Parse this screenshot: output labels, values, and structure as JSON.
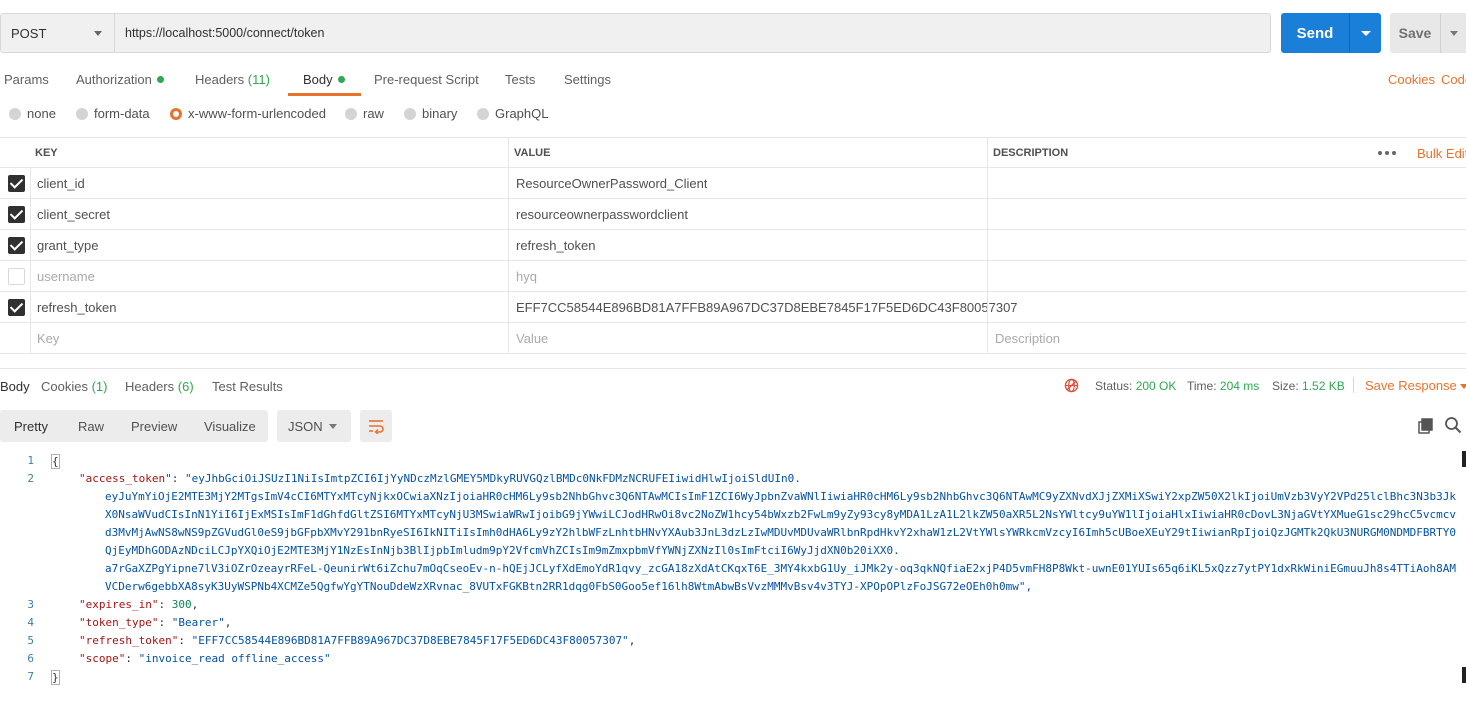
{
  "request": {
    "method": "POST",
    "url": "https://localhost:5000/connect/token",
    "send_label": "Send",
    "save_label": "Save"
  },
  "request_tabs": [
    {
      "label": "Params"
    },
    {
      "label": "Authorization",
      "dot": true
    },
    {
      "label": "Headers",
      "count": "(11)"
    },
    {
      "label": "Body",
      "dot": true,
      "active": true
    },
    {
      "label": "Pre-request Script"
    },
    {
      "label": "Tests"
    },
    {
      "label": "Settings"
    }
  ],
  "request_links": {
    "cookies": "Cookies",
    "code": "Code"
  },
  "body_types": {
    "none": "none",
    "form_data": "form-data",
    "urlencoded": "x-www-form-urlencoded",
    "raw": "raw",
    "binary": "binary",
    "graphql": "GraphQL",
    "selected": "x-www-form-urlencoded"
  },
  "params_table": {
    "headers": {
      "key": "KEY",
      "value": "VALUE",
      "description": "DESCRIPTION",
      "bulk_edit": "Bulk Edit"
    },
    "rows": [
      {
        "checked": true,
        "key": "client_id",
        "value": "ResourceOwnerPassword_Client",
        "description": ""
      },
      {
        "checked": true,
        "key": "client_secret",
        "value": "resourceownerpasswordclient",
        "description": ""
      },
      {
        "checked": true,
        "key": "grant_type",
        "value": "refresh_token",
        "description": ""
      },
      {
        "checked": false,
        "key": "username",
        "value": "hyq",
        "description": ""
      },
      {
        "checked": true,
        "key": "refresh_token",
        "value": "EFF7CC58544E896BD81A7FFB89A967DC37D8EBE7845F17F5ED6DC43F80057307",
        "description": ""
      }
    ],
    "placeholders": {
      "key": "Key",
      "value": "Value",
      "description": "Description"
    }
  },
  "response_tabs": [
    {
      "label": "Body",
      "active": true
    },
    {
      "label": "Cookies",
      "count": "(1)"
    },
    {
      "label": "Headers",
      "count": "(6)"
    },
    {
      "label": "Test Results"
    }
  ],
  "response_status": {
    "status_label": "Status:",
    "status_value": "200 OK",
    "time_label": "Time:",
    "time_value": "204 ms",
    "size_label": "Size:",
    "size_value": "1.52 KB",
    "save_response": "Save Response"
  },
  "response_view": {
    "formats": [
      "Pretty",
      "Raw",
      "Preview",
      "Visualize"
    ],
    "active_format": "Pretty",
    "language": "JSON"
  },
  "response_body": {
    "line_numbers": [
      "1",
      "2",
      "3",
      "4",
      "5",
      "6",
      "7"
    ],
    "open_brace": "{",
    "close_brace": "}",
    "access_token_key": "\"access_token\"",
    "access_token_lines": [
      "\"eyJhbGciOiJSUzI1NiIsImtpZCI6IjYyNDczMzlGMEY5MDkyRUVGQzlBMDc0NkFDMzNCRUFEIiwidHlwIjoiSldUIn0.",
      "eyJuYmYiOjE2MTE3MjY2MTgsImV4cCI6MTYxMTcyNjkxOCwiaXNzIjoiaHR0cHM6Ly9sb2NhbGhvc3Q6NTAwMCIsImF1ZCI6WyJpbnZvaWNlIiwiaHR0cHM6Ly9sb2NhbGhvc3Q6NTAwMC9yZXNvdXJjZXMiXSwiY2xpZW50X2lkIjoiUmVzb3VyY2VPd25lclBhc3N3b3Jk",
      "X0NsaWVudCIsInN1YiI6IjExMSIsImF1dGhfdGltZSI6MTYxMTcyNjU3MSwiaWRwIjoibG9jYWwiLCJodHRwOi8vc2NoZW1hcy54bWxzb2FwLm9yZy93cy8yMDA1LzA1L2lkZW50aXR5L2NsYWltcy9uYW1lIjoiaHlxIiwiaHR0cDovL3NjaGVtYXMueG1sc29hcC5vcmcv",
      "d3MvMjAwNS8wNS9pZGVudGl0eS9jbGFpbXMvY291bnRyeSI6IkNITiIsImh0dHA6Ly9zY2hlbWFzLnhtbHNvYXAub3JnL3dzLzIwMDUvMDUvaWRlbnRpdHkvY2xhaW1zL2VtYWlsYWRkcmVzcyI6Imh5cUBoeXEuY29tIiwianRpIjoiQzJGMTk2QkU3NURGM0NDMDFBRTY0",
      "QjEyMDhGODAzNDciLCJpYXQiOjE2MTE3MjY1NzEsInNjb3BlIjpbImludm9pY2VfcmVhZCIsIm9mZmxpbmVfYWNjZXNzIl0sImFtciI6WyJjdXN0b20iXX0.",
      "a7rGaXZPgYipne7lV3iOZrOzeayrRFeL-QeunirWt6iZchu7mOqCseoEv-n-hQEjJCLyfXdEmoYdR1qvy_zcGA18zXdAtCKqxT6E_3MY4kxbG1Uy_iJMk2y-oq3qkNQfiaE2xjP4D5vmFH8P8Wkt-uwnE01YUIs65q6iKL5xQzz7ytPY1dxRkWiniEGmuuJh8s4TTiAoh8AM",
      "VCDerw6gebbXA8syK3UyWSPNb4XCMZe5QgfwYgYTNouDdeWzXRvnac_8VUTxFGKBtn2RR1dqg0FbS0Goo5ef16lh8WtmAbwBsVvzMMMvBsv4v3TYJ-XPOpOPlzFoJSG72eOEh0h0mw\","
    ],
    "expires_in_key": "\"expires_in\"",
    "expires_in_value": "300",
    "token_type_key": "\"token_type\"",
    "token_type_value": "\"Bearer\"",
    "refresh_token_key": "\"refresh_token\"",
    "refresh_token_value": "\"EFF7CC58544E896BD81A7FFB89A967DC37D8EBE7845F17F5ED6DC43F80057307\"",
    "scope_key": "\"scope\"",
    "scope_value": "\"invoice_read offline_access\""
  },
  "icons": {
    "method_dropdown": "chevron-down-icon",
    "send_dropdown": "chevron-down-icon",
    "save_dropdown": "chevron-down-icon",
    "more": "more-horizontal-icon",
    "globe": "globe-icon",
    "wrap": "wrap-lines-icon",
    "copy": "copy-icon",
    "search": "search-icon"
  },
  "colors": {
    "accent": "#e8732c",
    "send": "#1a7fd9",
    "success": "#2fa84f"
  }
}
